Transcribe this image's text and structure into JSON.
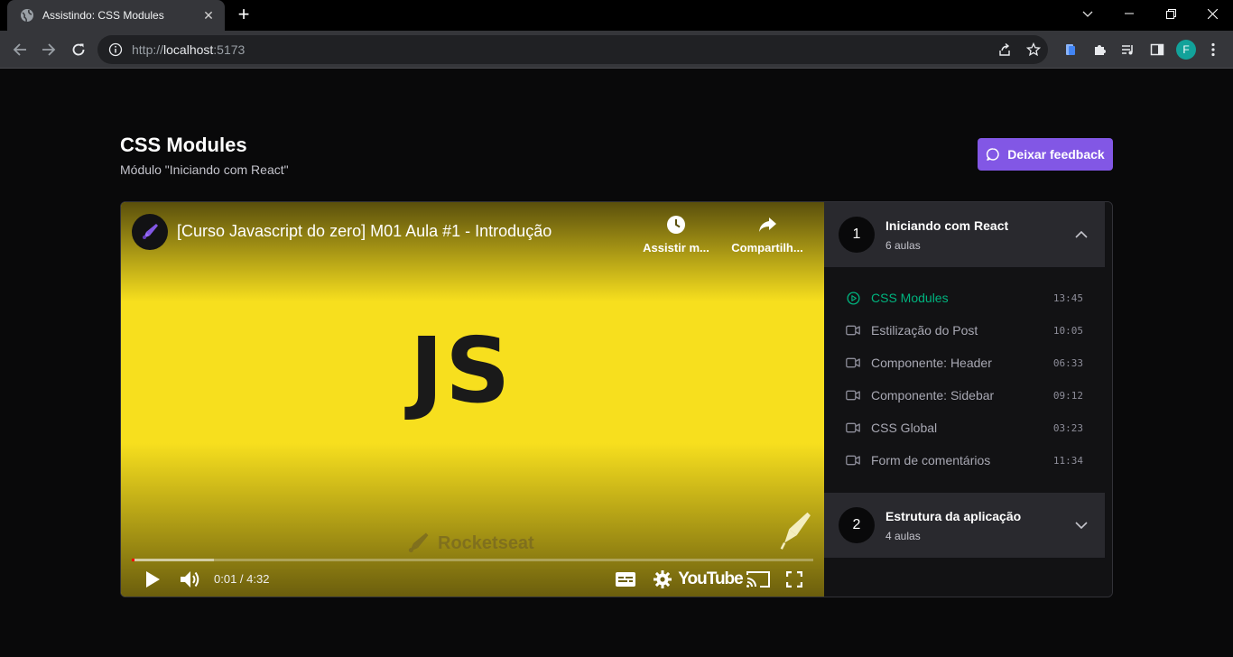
{
  "browser": {
    "tab_title": "Assistindo: CSS Modules",
    "url_prefix": "http://",
    "url_host": "localhost",
    "url_port": ":5173",
    "profile_initial": "F"
  },
  "header": {
    "title": "CSS Modules",
    "subtitle": "Módulo \"Iniciando com React\"",
    "feedback_label": "Deixar feedback"
  },
  "video": {
    "title": "[Curso Javascript do zero] M01 Aula #1 - Introdução",
    "watch_later_label": "Assistir m...",
    "share_label": "Compartilh...",
    "logo_text": "JS",
    "watermark_text": "Rocketseat",
    "time": "0:01 / 4:32",
    "brand": "YouTube",
    "progress_played": 0.004,
    "progress_buffered": 0.12
  },
  "modules": [
    {
      "number": "1",
      "title": "Iniciando com React",
      "count": "6 aulas",
      "expanded": true,
      "lessons": [
        {
          "name": "CSS Modules",
          "duration": "13:45",
          "active": true
        },
        {
          "name": "Estilização do Post",
          "duration": "10:05",
          "active": false
        },
        {
          "name": "Componente: Header",
          "duration": "06:33",
          "active": false
        },
        {
          "name": "Componente: Sidebar",
          "duration": "09:12",
          "active": false
        },
        {
          "name": "CSS Global",
          "duration": "03:23",
          "active": false
        },
        {
          "name": "Form de comentários",
          "duration": "11:34",
          "active": false
        }
      ]
    },
    {
      "number": "2",
      "title": "Estrutura da aplicação",
      "count": "4 aulas",
      "expanded": false,
      "lessons": []
    }
  ],
  "colors": {
    "accent_purple": "#8257e5",
    "active_green": "#00b37e",
    "js_yellow": "#f7df1e"
  }
}
